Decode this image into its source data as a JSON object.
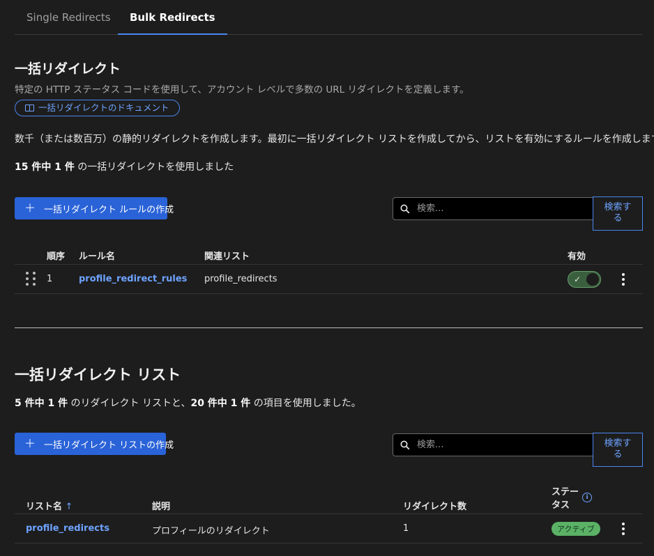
{
  "tabs": {
    "single": "Single Redirects",
    "bulk": "Bulk Redirects"
  },
  "section1": {
    "title": "一括リダイレクト",
    "description": "特定の HTTP ステータス コードを使用して、アカウント レベルで多数の URL リダイレクトを定義します。",
    "doc_link": "一括リダイレクトのドキュメント",
    "paragraph": "数千（または数百万）の静的リダイレクトを作成します。最初に一括リダイレクト リストを作成してから、リストを有効にするルールを作成します。",
    "usage_bold": "15 件中 1 件",
    "usage_rest": " の一括リダイレクトを使用しました",
    "create_button": "一括リダイレクト ルールの作成",
    "search_placeholder": "検索...",
    "search_button": "検索する",
    "table": {
      "headers": {
        "order": "順序",
        "rule_name": "ルール名",
        "related_list": "関連リスト",
        "enabled": "有効"
      },
      "rows": [
        {
          "order": "1",
          "rule_name": "profile_redirect_rules",
          "related_list": "profile_redirects",
          "enabled": true
        }
      ]
    }
  },
  "section2": {
    "title": "一括リダイレクト リスト",
    "usage_bold1": "5 件中 1 件",
    "usage_mid": " のリダイレクト リストと、",
    "usage_bold2": "20 件中 1 件",
    "usage_end": " の項目を使用しました。",
    "create_button": "一括リダイレクト リストの作成",
    "search_placeholder": "検索...",
    "search_button": "検索する",
    "table": {
      "headers": {
        "list_name": "リスト名",
        "sort_indicator": "↑",
        "description": "説明",
        "redirect_count": "リダイレクト数",
        "status": "ステータス",
        "status_line1": "ステー",
        "status_line2": "タス"
      },
      "rows": [
        {
          "list_name": "profile_redirects",
          "description": "プロフィールのリダイレクト",
          "redirect_count": "1",
          "status": "アクティブ"
        }
      ]
    }
  },
  "icons": {
    "doc": "book-icon",
    "plus": "plus-icon",
    "search": "search-icon",
    "drag": "drag-handle-icon",
    "check": "check-icon",
    "kebab": "kebab-menu-icon",
    "info": "info-icon"
  },
  "colors": {
    "background": "#1d1d1d",
    "accent": "#4a86f0",
    "primary_button": "#2a63d8",
    "toggle_on": "#3a5f3e",
    "badge_active": "#5bb266"
  }
}
